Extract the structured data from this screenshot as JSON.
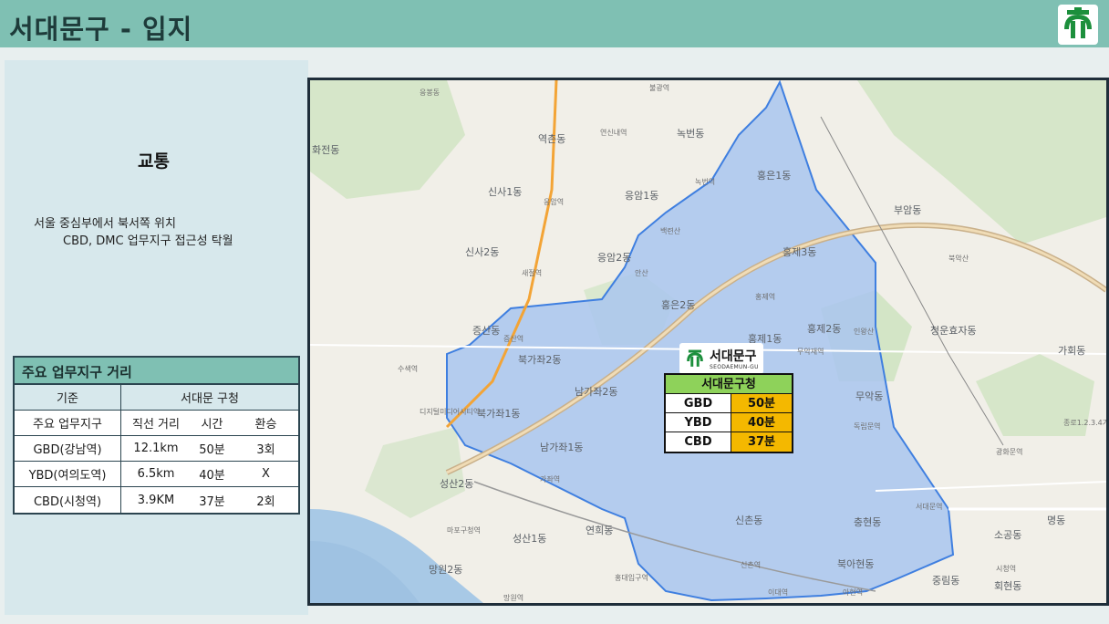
{
  "header": {
    "title": "서대문구 - 입지",
    "logo_icon": "seodaemun-logo-icon"
  },
  "left": {
    "section_title": "교통",
    "description_line1": "서울 중심부에서 북서쪽 위치",
    "description_line2": "CBD, DMC 업무지구 접근성 탁월"
  },
  "distance_table": {
    "title": "주요 업무지구 거리",
    "header_basis": "기준",
    "header_office": "서대문 구청",
    "sub_area": "주요 업무지구",
    "sub_distance": "직선 거리",
    "sub_time": "시간",
    "sub_transfer": "환승",
    "rows": [
      {
        "area": "GBD(강남역)",
        "distance": "12.1km",
        "time": "50분",
        "transfer": "3회"
      },
      {
        "area": "YBD(여의도역)",
        "distance": "6.5km",
        "time": "40분",
        "transfer": "X"
      },
      {
        "area": "CBD(시청역)",
        "distance": "3.9KM",
        "time": "37분",
        "transfer": "2회"
      }
    ]
  },
  "map": {
    "gu_name": "서대문구",
    "gu_name_en": "SEODAEMUN-GU",
    "time_box": {
      "title": "서대문구청",
      "rows": [
        {
          "key": "GBD",
          "value": "50분"
        },
        {
          "key": "YBD",
          "value": "40분"
        },
        {
          "key": "CBD",
          "value": "37분"
        }
      ]
    },
    "labels": {
      "l01": "역촌동",
      "l02": "녹번동",
      "l03": "신사1동",
      "l04": "응암1동",
      "l05": "홍은1동",
      "l06": "부암동",
      "l07": "신사2동",
      "l08": "응암2동",
      "l09": "홍제3동",
      "l10": "증산동",
      "l11": "홍은2동",
      "l12": "홍제1동",
      "l13": "홍제2동",
      "l14": "청운효자동",
      "l15": "북가좌2동",
      "l16": "남가좌2동",
      "l17": "무악동",
      "l18": "북가좌1동",
      "l19": "남가좌1동",
      "l20": "성산2동",
      "l21": "신촌동",
      "l22": "충현동",
      "l23": "성산1동",
      "l24": "연희동",
      "l25": "망원2동",
      "l26": "북아현동",
      "l27": "중림동",
      "l28": "가회동",
      "l29": "소공동",
      "l30": "회현동",
      "l31": "명동",
      "l32": "응봉동",
      "l33": "수색역",
      "l34": "디지털미디어시티역",
      "l35": "가좌역",
      "l36": "신촌역",
      "l37": "홍대입구역",
      "l38": "이대역",
      "l39": "아현역",
      "l40": "서대문역",
      "l41": "독립문역",
      "l42": "무악재역",
      "l43": "홍제역",
      "l44": "녹번역",
      "l45": "응암역",
      "l46": "새절역",
      "l47": "증산역",
      "l48": "불광역",
      "l49": "연신내역",
      "l50": "시청역",
      "l51": "광화문역",
      "l52": "마포구청역",
      "l53": "망원역",
      "l54": "종로1.2.3.4가",
      "l55": "화전동",
      "l56": "인왕산",
      "l57": "안산",
      "l58": "북악산",
      "l59": "백련산"
    }
  },
  "colors": {
    "header": "#7fc0b3",
    "panel": "#d7e8ec",
    "district_fill": "#a9c6ef",
    "district_stroke": "#3f7fe0",
    "time_value": "#f4b800",
    "time_header": "#8ed25a"
  }
}
